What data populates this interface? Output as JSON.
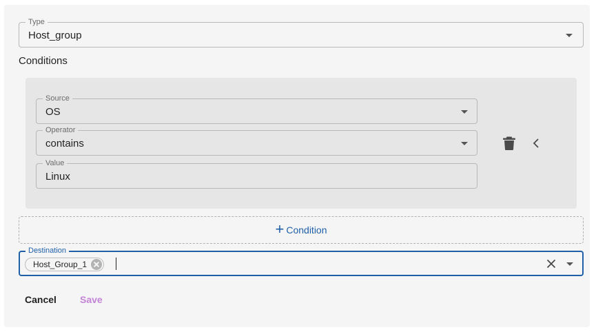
{
  "type_field": {
    "legend": "Type",
    "value": "Host_group"
  },
  "conditions": {
    "label": "Conditions",
    "items": [
      {
        "source": {
          "legend": "Source",
          "value": "OS"
        },
        "operator": {
          "legend": "Operator",
          "value": "contains"
        },
        "value": {
          "legend": "Value",
          "value": "Linux"
        }
      }
    ],
    "add_label": "Condition"
  },
  "destination": {
    "legend": "Destination",
    "chips": [
      "Host_Group_1"
    ]
  },
  "actions": {
    "cancel_label": "Cancel",
    "save_label": "Save"
  },
  "colors": {
    "accent": "#1e5fa8",
    "save_disabled": "#c383d6",
    "card_bg": "#e6e6e6"
  },
  "icons": [
    "caret-down-icon",
    "trash-icon",
    "chevron-left-icon",
    "plus-icon",
    "chip-remove-icon",
    "clear-icon"
  ]
}
